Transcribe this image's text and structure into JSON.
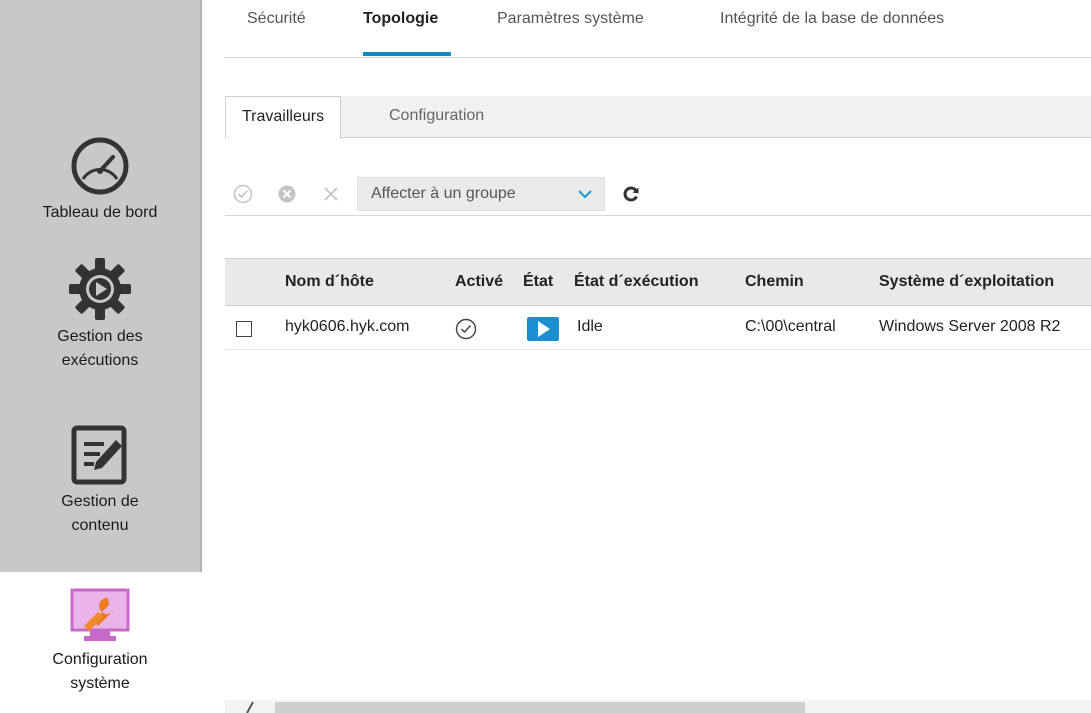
{
  "sidebar": {
    "items": [
      {
        "label": "Tableau de bord",
        "icon": "dashboard-gauge-icon"
      },
      {
        "label": "Gestion des\nexécutions",
        "icon": "gear-play-icon"
      },
      {
        "label": "Gestion de\ncontenu",
        "icon": "edit-document-icon"
      },
      {
        "label": "Configuration\nsystème",
        "icon": "wrench-monitor-icon"
      }
    ]
  },
  "top_tabs": [
    "Sécurité",
    "Topologie",
    "Paramètres système",
    "Intégrité de la base de données"
  ],
  "top_tabs_active": "Topologie",
  "sub_tabs": [
    "Travailleurs",
    "Configuration"
  ],
  "sub_tabs_active": "Travailleurs",
  "toolbar": {
    "assign_group": "Affecter à un groupe",
    "icons": [
      "enable-check-icon",
      "disable-x-circle-icon",
      "remove-x-icon",
      "chevron-down-icon",
      "refresh-icon"
    ]
  },
  "table": {
    "columns": [
      "Nom d´hôte",
      "Activé",
      "État",
      "État d´exécution",
      "Chemin",
      "Système d´exploitation"
    ],
    "rows": [
      {
        "hostname": "hyk0606.hyk.com",
        "enabled_icon": "check-circle-icon",
        "state_icon": "play-icon",
        "execution_state": "Idle",
        "path": "C:\\00\\central",
        "os": "Windows Server 2008 R2"
      }
    ]
  },
  "colors": {
    "accent": "#0b8ec5",
    "play_button": "#1a8fd0",
    "sidebar_bg": "#c8c8c8",
    "config_icon": "#c868c8"
  }
}
